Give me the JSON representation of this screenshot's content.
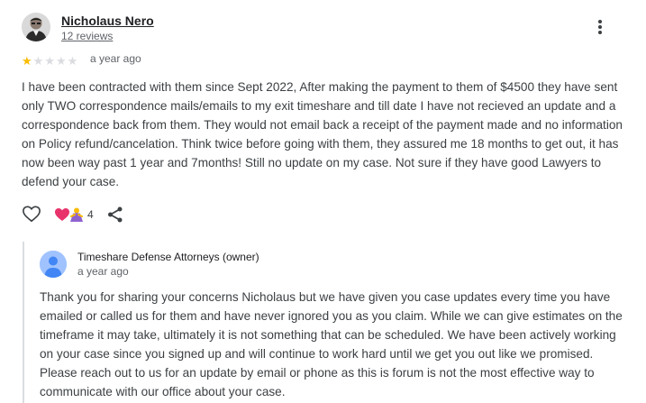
{
  "review": {
    "author_name": "Nicholaus Nero",
    "review_count": "12 reviews",
    "rating": 1,
    "max_rating": 5,
    "time": "a year ago",
    "text": "I have been contracted with them since Sept 2022, After making the payment to them of $4500 they have sent only TWO correspondence mails/emails to my exit timeshare and till date I have not recieved an update and a correspondence back from them. They would not email back a receipt of the payment made and no information on Policy refund/cancelation. Think twice before going with them, they assured me 18 months to get out, it has now been way past 1 year and 7months! Still no update on my case. Not sure if they have good Lawyers to defend your case.",
    "reaction_count": "4"
  },
  "icons": {
    "more": "more-vert-icon",
    "like": "heart-outline-icon",
    "reactions": "reaction-emoji-icons",
    "share": "share-icon",
    "owner_avatar": "person-icon"
  },
  "colors": {
    "star_filled": "#fbbc04",
    "star_empty": "#dadce0",
    "owner_avatar_bg": "#a0c3ff",
    "owner_avatar_fg": "#4285f4",
    "reply_border": "#dadce0"
  },
  "owner_reply": {
    "name": "Timeshare Defense Attorneys (owner)",
    "time": "a year ago",
    "text": "Thank you for sharing your concerns Nicholaus but we have given you case updates every time you have emailed or called us for them and have never ignored you as you claim. While we can give estimates on the timeframe it may take, ultimately it is not something that can be scheduled. We have been actively working on your case since you signed up and will continue to work hard until we get you out like we promised. Please reach out to us for an update by email or phone as this is forum is not the most effective way to communicate with our office about your case."
  }
}
